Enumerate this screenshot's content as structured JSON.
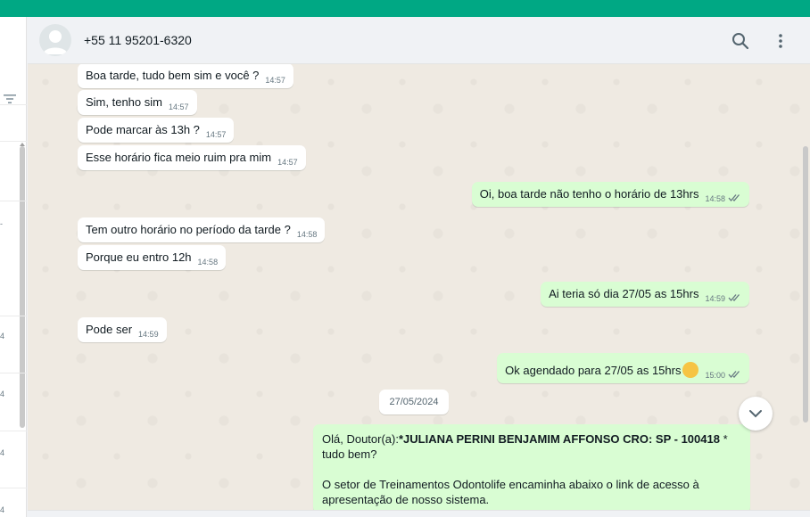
{
  "colors": {
    "accent": "#00a884",
    "incoming": "#ffffff",
    "outgoing": "#d9fdd3",
    "chat_bg": "#efeae2",
    "read_check": "#667781"
  },
  "header": {
    "contact": "+55 11 95201-6320",
    "icons": [
      "search-icon",
      "menu-icon"
    ]
  },
  "left_panel": {
    "row_marks": [
      "4",
      "4",
      "4",
      "4"
    ]
  },
  "messages": [
    {
      "dir": "in",
      "text": "Boa tarde, tudo bem sim e você ?",
      "time": "14:57"
    },
    {
      "dir": "in",
      "text": "Sim, tenho sim",
      "time": "14:57"
    },
    {
      "dir": "in",
      "text": "Pode marcar às 13h ?",
      "time": "14:57"
    },
    {
      "dir": "in",
      "text": "Esse horário fica meio ruim pra mim",
      "time": "14:57"
    },
    {
      "dir": "out",
      "text": "Oi, boa tarde  não tenho o horário de 13hrs",
      "time": "14:58"
    },
    {
      "dir": "in",
      "text": "Tem outro horário no período da tarde ?",
      "time": "14:58"
    },
    {
      "dir": "in",
      "text": "Porque eu entro 12h",
      "time": "14:58"
    },
    {
      "dir": "out",
      "text": "Ai teria só dia 27/05 as 15hrs",
      "time": "14:59"
    },
    {
      "dir": "in",
      "text": "Pode ser",
      "time": "14:59"
    },
    {
      "dir": "out",
      "text": "Ok agendado para 27/05 as 15hrs",
      "time": "15:00",
      "emoji": "smirk-emoji"
    }
  ],
  "date_chip": "27/05/2024",
  "long_message": {
    "prefix": "Olá, Doutor(a):",
    "bold": "*JULIANA PERINI BENJAMIM AFFONSO CRO: SP - 100418",
    "suffix": " * tudo bem?",
    "paragraph2": "O setor de Treinamentos Odontolife encaminha abaixo o link de acesso à apresentação de nosso sistema."
  }
}
